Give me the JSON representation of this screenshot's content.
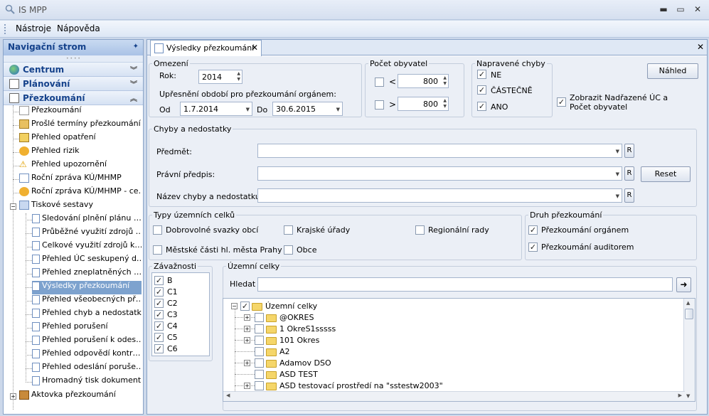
{
  "window": {
    "title": "IS MPP",
    "min": "▬",
    "max": "▭",
    "close": "✕"
  },
  "menu": [
    "Nástroje",
    "Nápověda"
  ],
  "nav": {
    "header": "Navigační strom",
    "pin": "✦",
    "groups": {
      "centrum": "Centrum",
      "planovani": "Plánování",
      "prezkoumani": "Přezkoumání"
    },
    "items": [
      "Přezkoumání",
      "Prošlé termíny přezkoumání",
      "Přehled opatření",
      "Přehled rizik",
      "Přehled upozornění",
      "Roční zpráva KÚ/MHMP",
      "Roční zpráva KÚ/MHMP - ce…",
      "Tiskové sestavy"
    ],
    "sub": [
      "Sledování plnění plánu …",
      "Průběžné využití zdrojů …",
      "Celkové využití zdrojů k…",
      "Přehled ÚC seskupený d…",
      "Přehled zneplatněných …",
      "Výsledky přezkoumání",
      "Přehled všeobecných př…",
      "Přehled chyb a nedostatků",
      "Přehled porušení",
      "Přehled porušení k odes…",
      "Přehled odpovědí kontr…",
      "Přehled odeslání poruše…",
      "Hromadný tisk dokumentů"
    ],
    "last": "Aktovka přezkoumání"
  },
  "tab": {
    "label": "Výsledky přezkoumání",
    "close": "✕"
  },
  "omezeni": {
    "legend": "Omezení",
    "rok_label": "Rok:",
    "rok": "2014",
    "upresneni": "Upřesnění období pro přezkoumání orgánem:",
    "od_label": "Od",
    "od": "1.7.2014",
    "do_label": "Do",
    "do": "30.6.2015"
  },
  "pocet": {
    "legend": "Počet obyvatel",
    "lt": "<",
    "lt_val": "800",
    "gt": ">",
    "gt_val": "800"
  },
  "napravene": {
    "legend": "Napravené chyby",
    "items": [
      "NE",
      "ČÁSTEČNĚ",
      "ANO"
    ]
  },
  "nahled": "Náhled",
  "zobrazit": {
    "line1": "Zobrazit Nadřazené ÚC a",
    "line2": "Počet obyvatel"
  },
  "chyby": {
    "legend": "Chyby a nedostatky",
    "predmet": "Předmět:",
    "pravni": "Právní předpis:",
    "nazev": "Název chyby a nedostatku:",
    "r": "R",
    "reset": "Reset"
  },
  "typy": {
    "legend": "Typy územních celků",
    "items": [
      "Dobrovolné svazky obcí",
      "Krajské úřady",
      "Regionální rady",
      "Městské části hl. města Prahy",
      "Obce"
    ]
  },
  "druh": {
    "legend": "Druh přezkoumání",
    "items": [
      "Přezkoumání orgánem",
      "Přezkoumání auditorem"
    ]
  },
  "zavaznosti": {
    "legend": "Závažnosti",
    "items": [
      "B",
      "C1",
      "C2",
      "C3",
      "C4",
      "C5",
      "C6"
    ]
  },
  "uzemni": {
    "legend": "Územní celky",
    "hledat": "Hledat",
    "go": "➜",
    "root": "Územní celky",
    "items": [
      "@OKRES",
      "1 OkreS1sssss",
      "101 Okres",
      "A2",
      "Adamov DSO",
      "ASD TEST",
      "ASD testovací prostředí na \"sstestw2003\""
    ]
  },
  "check": "✓",
  "colors": {
    "accent": "#15428b",
    "selection": "#7da2ce",
    "background": "#ebeff6"
  }
}
